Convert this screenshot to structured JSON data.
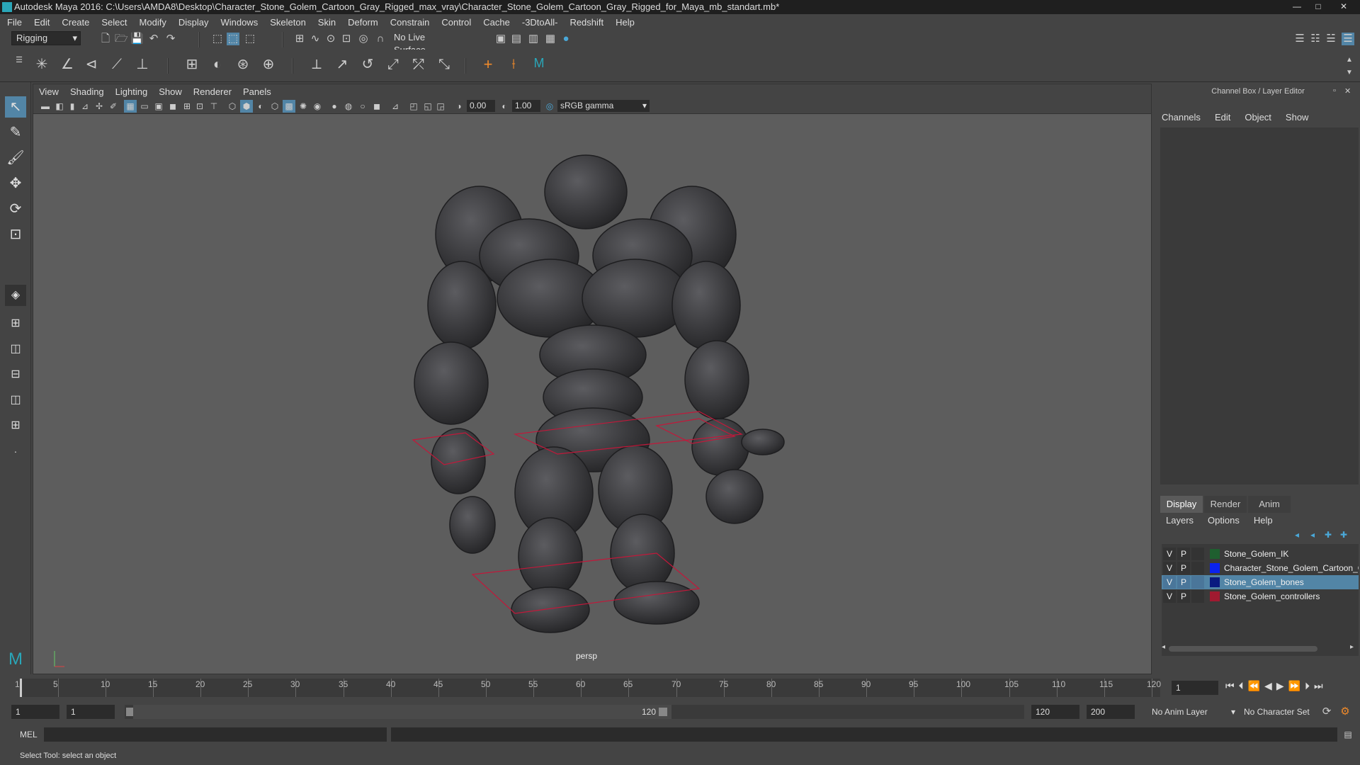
{
  "window": {
    "title": "Autodesk Maya 2016: C:\\Users\\AMDA8\\Desktop\\Character_Stone_Golem_Cartoon_Gray_Rigged_max_vray\\Character_Stone_Golem_Cartoon_Gray_Rigged_for_Maya_mb_standart.mb*",
    "controls": {
      "minimize": "—",
      "maximize": "□",
      "close": "✕"
    }
  },
  "menubar": [
    "File",
    "Edit",
    "Create",
    "Select",
    "Modify",
    "Display",
    "Windows",
    "Skeleton",
    "Skin",
    "Deform",
    "Constrain",
    "Control",
    "Cache",
    "-3DtoAll-",
    "Redshift",
    "Help"
  ],
  "status_line": {
    "menu_set": "Rigging",
    "live_surface": "No Live Surface"
  },
  "viewport": {
    "menu": [
      "View",
      "Shading",
      "Lighting",
      "Show",
      "Renderer",
      "Panels"
    ],
    "exposure": "0.00",
    "gamma": "1.00",
    "color_space": "sRGB gamma",
    "camera_label": "persp"
  },
  "channel_box": {
    "title": "Channel Box / Layer Editor",
    "menu": [
      "Channels",
      "Edit",
      "Object",
      "Show"
    ]
  },
  "layer_editor": {
    "tabs": [
      "Display",
      "Render",
      "Anim"
    ],
    "active_tab": "Display",
    "menu": [
      "Layers",
      "Options",
      "Help"
    ],
    "layers": [
      {
        "v": "V",
        "p": "P",
        "color": "#1f5f2f",
        "name": "Stone_Golem_IK",
        "selected": false
      },
      {
        "v": "V",
        "p": "P",
        "color": "#0a22ee",
        "name": "Character_Stone_Golem_Cartoon_G",
        "selected": false
      },
      {
        "v": "V",
        "p": "P",
        "color": "#0a1a80",
        "name": "Stone_Golem_bones",
        "selected": true
      },
      {
        "v": "V",
        "p": "P",
        "color": "#a01a30",
        "name": "Stone_Golem_controllers",
        "selected": false
      }
    ]
  },
  "timeline": {
    "ticks": [
      "1",
      "5",
      "10",
      "15",
      "20",
      "25",
      "30",
      "35",
      "40",
      "45",
      "50",
      "55",
      "60",
      "65",
      "70",
      "75",
      "80",
      "85",
      "90",
      "95",
      "100",
      "105",
      "110",
      "115",
      "120"
    ],
    "current_frame": "1"
  },
  "range": {
    "start": "1",
    "playback_start": "1",
    "slider_start": "1",
    "slider_end": "120",
    "playback_end": "120",
    "end": "200",
    "anim_layer": "No Anim Layer",
    "character_set": "No Character Set"
  },
  "command_line": {
    "label": "MEL"
  },
  "help_line": {
    "text": "Select Tool: select an object"
  }
}
